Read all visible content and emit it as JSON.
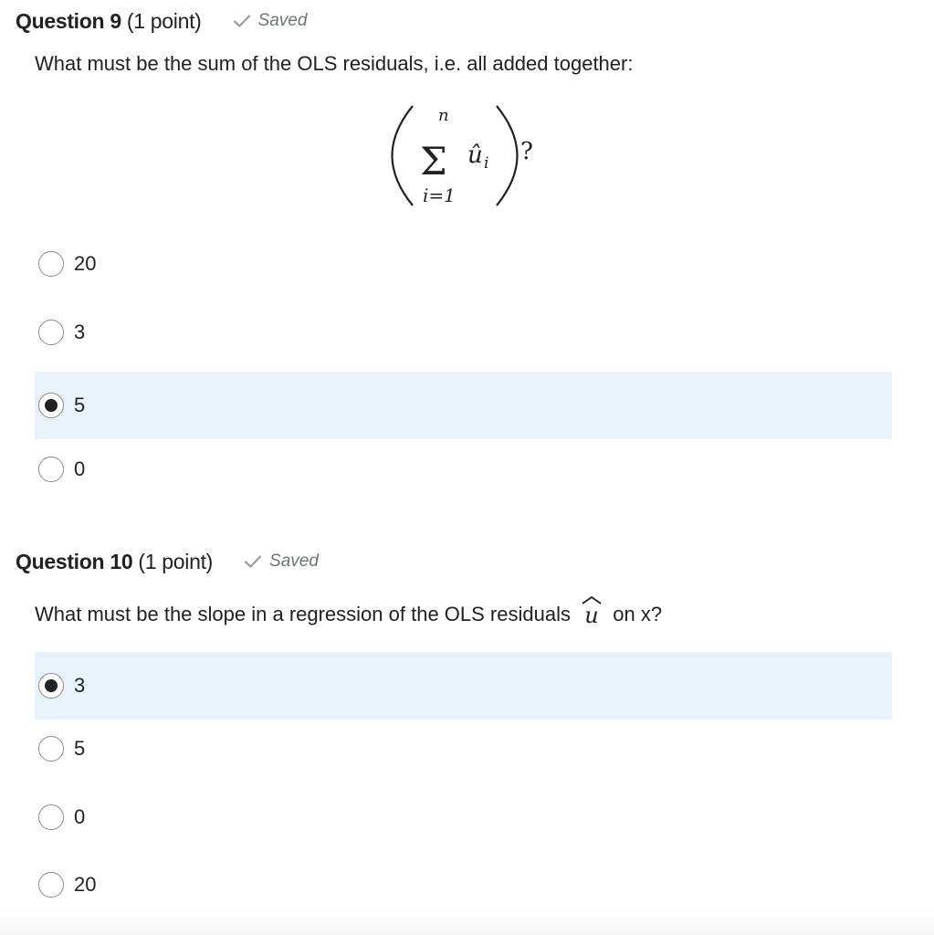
{
  "questions": [
    {
      "title": "Question 9",
      "points": "(1 point)",
      "status": "Saved",
      "text": "What must be the sum of the OLS residuals, i.e. all added together:",
      "formula": {
        "upper": "n",
        "lower": "i=1",
        "symbol": "Σ",
        "term": "û",
        "subscript": "i",
        "suffix": "?"
      },
      "options": [
        {
          "label": "20",
          "selected": false
        },
        {
          "label": "3",
          "selected": false
        },
        {
          "label": "5",
          "selected": true
        },
        {
          "label": "0",
          "selected": false
        }
      ]
    },
    {
      "title": "Question 10",
      "points": "(1 point)",
      "status": "Saved",
      "text_before": "What must be the slope in a regression of the OLS residuals",
      "text_symbol": "û",
      "text_after": "on x?",
      "options": [
        {
          "label": "3",
          "selected": true
        },
        {
          "label": "5",
          "selected": false
        },
        {
          "label": "0",
          "selected": false
        },
        {
          "label": "20",
          "selected": false
        }
      ]
    }
  ],
  "icons": {
    "saved": "checkmark-icon",
    "radio_selected": "radio-selected-icon",
    "radio_empty": "radio-empty-icon"
  },
  "colors": {
    "selected_row": "#e9f2fb",
    "text": "#202122",
    "muted": "#6e7376"
  }
}
